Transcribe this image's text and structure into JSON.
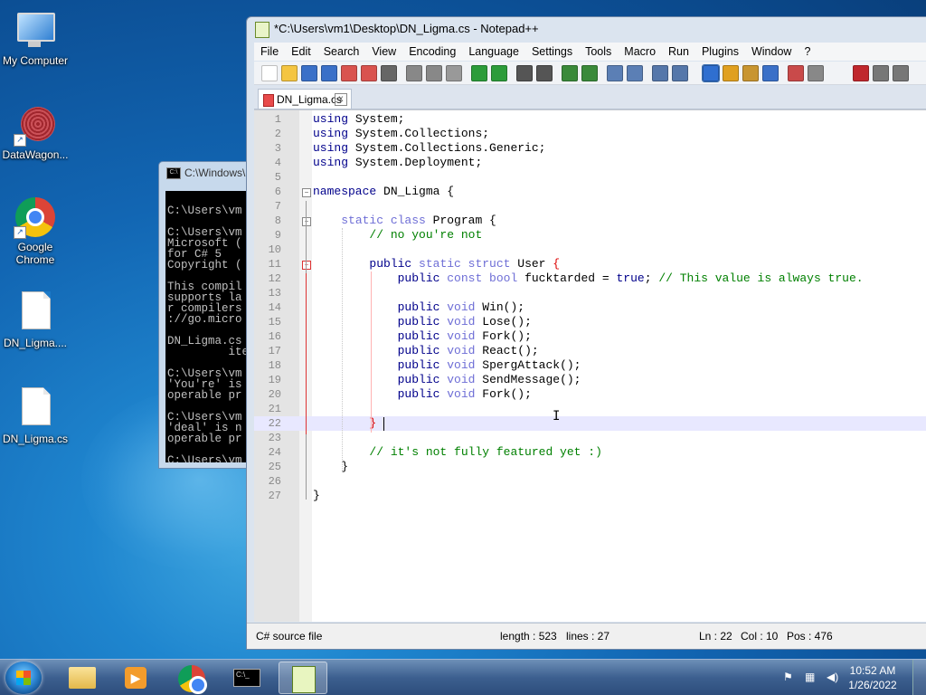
{
  "desktop": {
    "icons": [
      {
        "label": "My Computer"
      },
      {
        "label": "DataWagon..."
      },
      {
        "label": "Google Chrome"
      },
      {
        "label": "DN_Ligma...."
      },
      {
        "label": "DN_Ligma.cs"
      }
    ]
  },
  "cmd": {
    "title": "C:\\Windows\\",
    "lines": [
      "",
      "C:\\Users\\vm",
      "",
      "C:\\Users\\vm",
      "Microsoft (",
      "for C# 5",
      "Copyright (",
      "",
      "This compil",
      "supports la",
      "r compilers",
      "://go.micro",
      "",
      "DN_Ligma.cs",
      "         ite",
      "",
      "C:\\Users\\vm",
      "'You're' is",
      "operable pr",
      "",
      "C:\\Users\\vm",
      "'deal' is n",
      "operable pr",
      "",
      "C:\\Users\\vm"
    ]
  },
  "npp": {
    "title": "*C:\\Users\\vm1\\Desktop\\DN_Ligma.cs - Notepad++",
    "menu": [
      "File",
      "Edit",
      "Search",
      "View",
      "Encoding",
      "Language",
      "Settings",
      "Tools",
      "Macro",
      "Run",
      "Plugins",
      "Window",
      "?"
    ],
    "tab": "DN_Ligma.cs",
    "tab_close": "x",
    "status": {
      "filetype": "C# source file",
      "length": "length : 523",
      "lines": "lines : 27",
      "ln": "Ln : 22",
      "col": "Col : 10",
      "pos": "Pos : 476"
    }
  },
  "taskbar": {
    "time": "10:52 AM",
    "date": "1/26/2022"
  },
  "colors": {
    "keyword": "#00008b",
    "keyword2": "#8000ff",
    "comment": "#008000",
    "brace_highlight": "#dd0000",
    "current_line": "#e8e8ff"
  }
}
